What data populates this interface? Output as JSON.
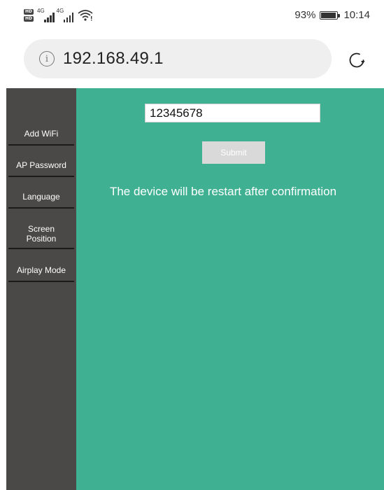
{
  "status_bar": {
    "hd_badges": [
      "HD",
      "HD"
    ],
    "network_1": "4G",
    "network_2": "4G",
    "battery_percent": "93%",
    "battery_level": 0.93,
    "time": "10:14",
    "icons": [
      "hd-icon",
      "signal-icon",
      "signal-icon",
      "wifi-icon",
      "battery-icon"
    ]
  },
  "browser": {
    "url": "192.168.49.1",
    "info_icon_glyph": "i",
    "icons": [
      "info-icon",
      "reload-icon"
    ]
  },
  "sidebar": {
    "items": [
      {
        "label": "Add WiFi"
      },
      {
        "label": "AP Password"
      },
      {
        "label": "Language"
      },
      {
        "label": "Screen Position"
      },
      {
        "label": "Airplay Mode"
      }
    ]
  },
  "main": {
    "password_value": "12345678",
    "submit_label": "Submit",
    "notice": "The device will be restart after confirmation"
  },
  "colors": {
    "sidebar_bg": "#4b4848",
    "content_bg": "#3fb192",
    "button_bg": "#d9d9d9"
  }
}
